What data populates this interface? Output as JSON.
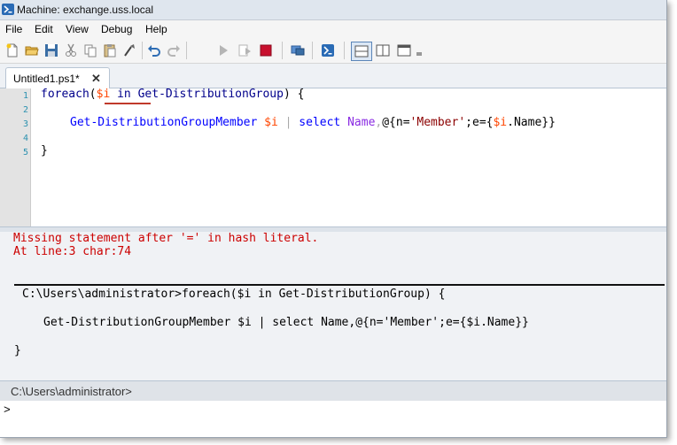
{
  "window": {
    "title": "Machine: exchange.uss.local"
  },
  "menu": [
    "File",
    "Edit",
    "View",
    "Debug",
    "Help"
  ],
  "toolbar": {
    "icons": [
      "new-file-icon",
      "open-folder-icon",
      "save-icon",
      "cut-icon",
      "copy-icon",
      "paste-icon",
      "clear-icon",
      "undo-icon",
      "redo-icon",
      "run-script-icon",
      "run-selection-icon",
      "stop-icon",
      "remote-powershell-icon",
      "powershell-console-icon",
      "layout-top-icon",
      "layout-right-icon",
      "layout-max-icon"
    ]
  },
  "tabs": [
    {
      "label": "Untitled1.ps1*",
      "close": "✕"
    }
  ],
  "editor": {
    "line_numbers": [
      "1",
      "2",
      "3",
      "4",
      "5"
    ],
    "line1": {
      "kw": "foreach",
      "open": "(",
      "var": "$i",
      "in": " in ",
      "cmd": "Get-DistributionGroup",
      "close": ") {"
    },
    "line3": {
      "cmd": "Get-DistributionGroupMember",
      "sp1": " ",
      "var": "$i",
      "pipe": " | ",
      "select": "select",
      "sp2": " ",
      "args": "Name",
      "comma": ",",
      "hash": "@{n=",
      "str": "'Member'",
      "semi": ";e={",
      "var2": "$i",
      "prop": ".Name}}"
    },
    "line5": "}"
  },
  "output": {
    "error_lines": [
      "Missing statement after '=' in hash literal.",
      "At line:3 char:74"
    ],
    "echo_lines": [
      "C:\\Users\\administrator>foreach($i in Get-DistributionGroup) {",
      "Get-DistributionGroupMember $i | select Name,@{n='Member';e={$i.Name}}",
      "}"
    ]
  },
  "prompt": {
    "path": "C:\\Users\\administrator>"
  },
  "command_input": {
    "value": ">"
  }
}
